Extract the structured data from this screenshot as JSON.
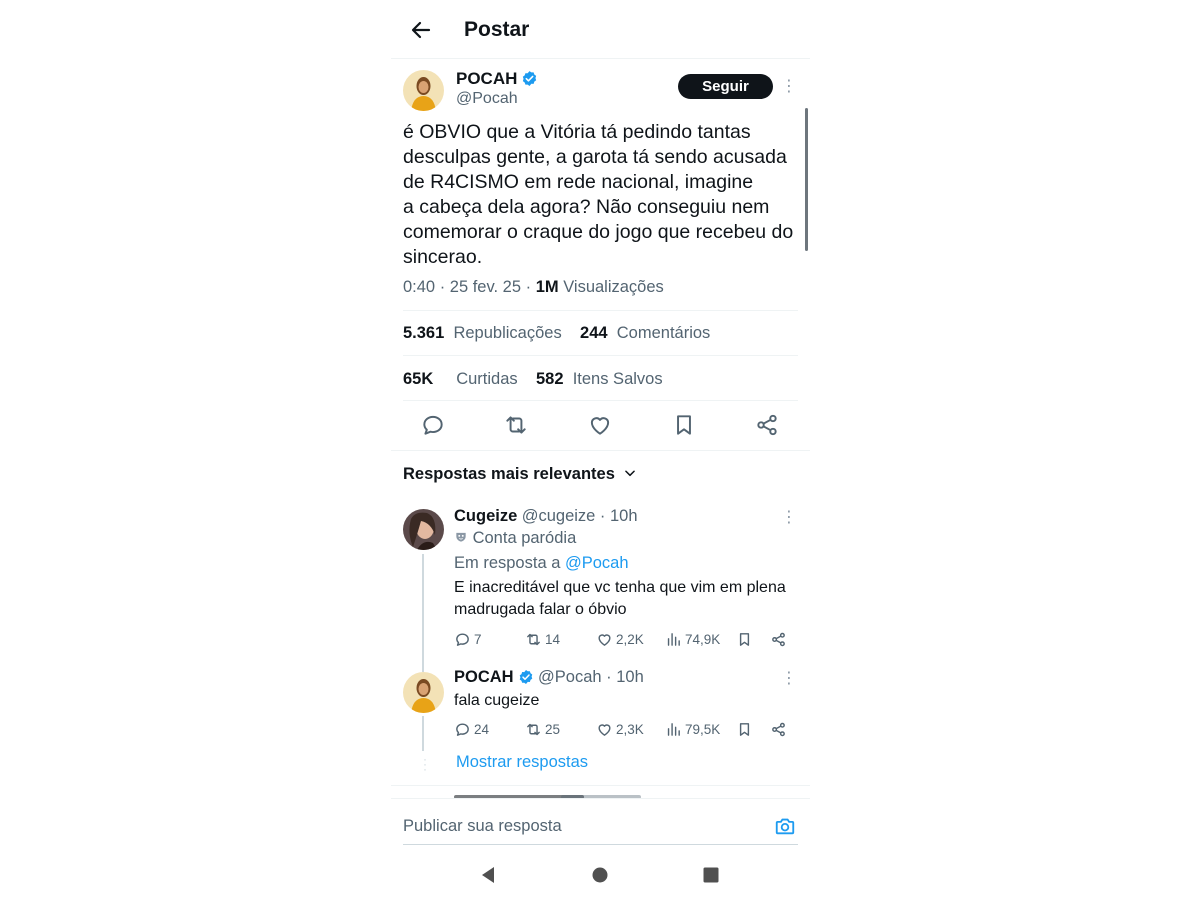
{
  "header": {
    "title": "Postar"
  },
  "main_post": {
    "author_name": "POCAH",
    "author_handle": "@Pocah",
    "follow_label": "Seguir",
    "text": "é OBVIO que a Vitória tá pedindo tantas\ndesculpas gente, a garota tá sendo acusada\nde R4CISMO em rede nacional, imagine\na cabeça dela agora? Não conseguiu nem\ncomemorar o craque do jogo que recebeu do\nsincerao.",
    "time": "0:40 · 25 fev. 25 · ",
    "views_count": "1M",
    "views_label": " Visualizações",
    "reposts_count": "5.361",
    "reposts_label": "Republicações",
    "comments_count": "244",
    "comments_label": "Comentários",
    "likes_count": "65K",
    "likes_label": "Curtidas",
    "saves_count": "582",
    "saves_label": "Itens Salvos"
  },
  "replies_section": {
    "label": "Respostas mais relevantes"
  },
  "replies": [
    {
      "name": "Cugeize",
      "handle": "@cugeize · 10h",
      "badge": "Conta paródia",
      "in_reply_prefix": "Em resposta a ",
      "in_reply_handle": "@Pocah",
      "text": "E inacreditável que vc tenha que vim em plena\nmadrugada falar o óbvio",
      "replies": "7",
      "reposts": "14",
      "likes": "2,2K",
      "views": "74,9K"
    },
    {
      "name": "POCAH",
      "handle": "@Pocah · 10h",
      "text": "fala cugeize",
      "replies": "24",
      "reposts": "25",
      "likes": "2,3K",
      "views": "79,5K",
      "show_replies": "Mostrar respostas"
    }
  ],
  "composer": {
    "placeholder": "Publicar sua resposta"
  },
  "icons": {
    "back": "arrow-left-icon",
    "verified": "verified-badge-icon",
    "reply": "speech-bubble-icon",
    "repost": "repost-icon",
    "like": "heart-icon",
    "bookmark": "bookmark-icon",
    "share": "share-icon",
    "views": "bar-chart-icon",
    "camera": "camera-icon"
  },
  "colors": {
    "accent": "#1d9bf0",
    "text": "#0f1419",
    "muted": "#536471"
  }
}
